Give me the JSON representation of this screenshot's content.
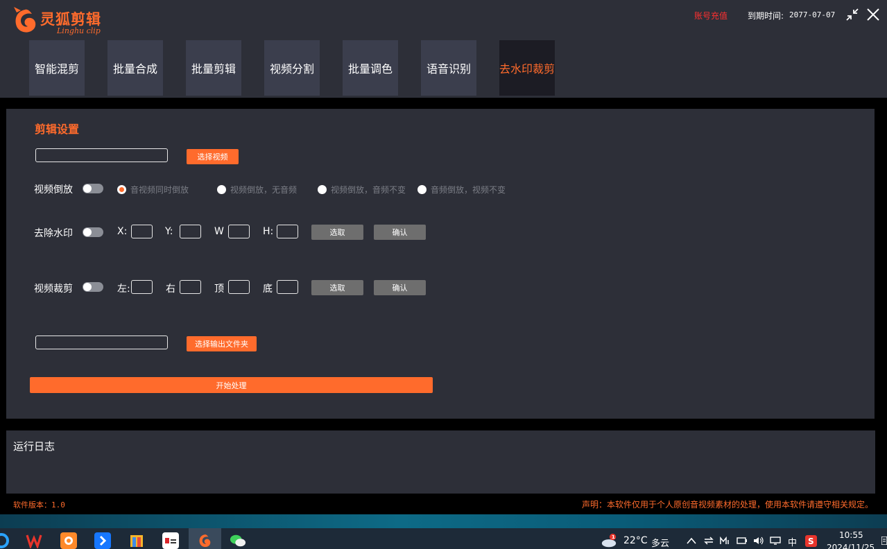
{
  "app": {
    "name": "灵狐剪辑",
    "subtitle": "Linghu clip",
    "recharge": "账号充值",
    "expiry_label": "到期时间:",
    "expiry_value": "2077-07-07"
  },
  "tabs": [
    {
      "label": "智能混剪"
    },
    {
      "label": "批量合成"
    },
    {
      "label": "批量剪辑"
    },
    {
      "label": "视频分割"
    },
    {
      "label": "批量调色"
    },
    {
      "label": "语音识别"
    },
    {
      "label": "去水印裁剪"
    }
  ],
  "settings": {
    "title": "剪辑设置",
    "video_path": "",
    "choose_video": "选择视频",
    "reverse": {
      "label": "视频倒放",
      "options": [
        "音视频同时倒放",
        "视频倒放，无音频",
        "视频倒放，音频不变",
        "音频倒放，视频不变"
      ],
      "selected": "音视频同时倒放"
    },
    "watermark": {
      "label": "去除水印",
      "x_label": "X:",
      "y_label": "Y:",
      "w_label": "W",
      "h_label": "H:",
      "select": "选取",
      "confirm": "确认"
    },
    "crop": {
      "label": "视频裁剪",
      "left_label": "左:",
      "right_label": "右",
      "top_label": "顶",
      "bottom_label": "底",
      "select": "选取",
      "confirm": "确认"
    },
    "output_path": "",
    "choose_output": "选择输出文件夹",
    "start": "开始处理"
  },
  "log": {
    "title": "运行日志"
  },
  "footer": {
    "version": "软件版本：1.0",
    "statement": "声明：本软件仅用于个人原创音视频素材的处理，使用本软件请遵守相关规定。"
  },
  "taskbar": {
    "weather_badge": "1",
    "weather_temp": "22°C",
    "weather_desc": "多云",
    "ime": "中",
    "time": "10:55",
    "date": "2024/11/25"
  },
  "colors": {
    "accent": "#ff6b2c",
    "panel": "#2d2f38",
    "tab": "#3b3e4d",
    "tab_active": "#1c1c24",
    "warning": "#ff3030"
  }
}
